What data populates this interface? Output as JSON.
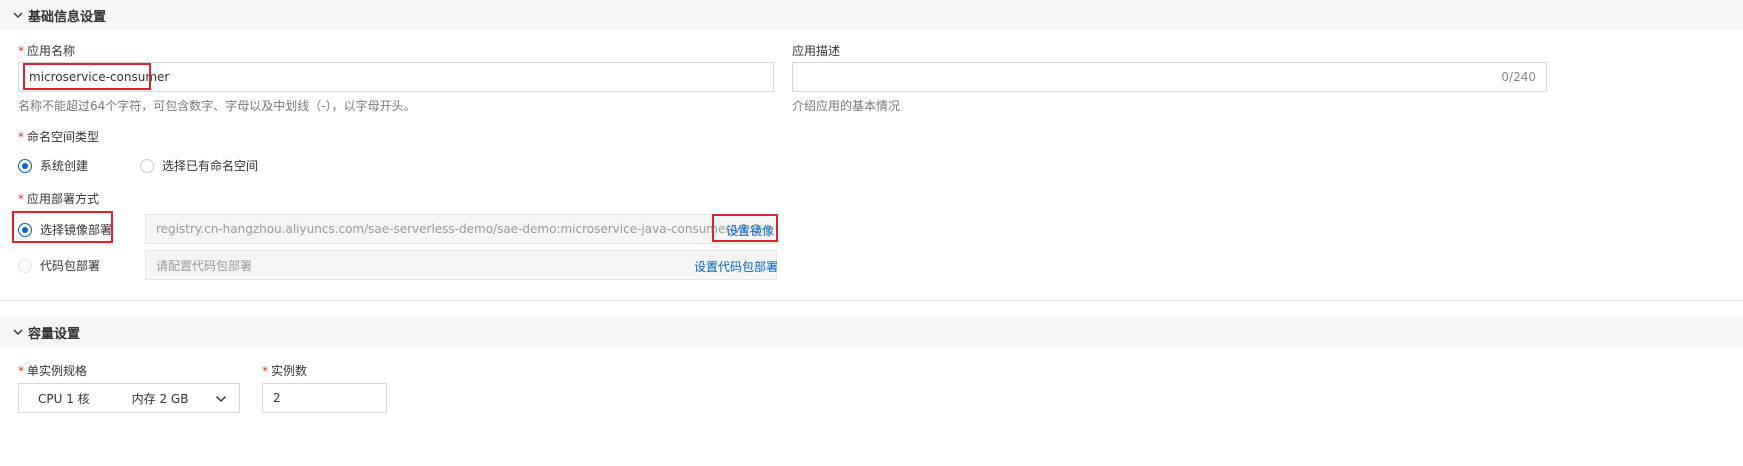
{
  "basic": {
    "section_title": "基础信息设置",
    "app_name": {
      "label": "应用名称",
      "value": "microservice-consumer",
      "hint": "名称不能超过64个字符，可包含数字、字母以及中划线（-），以字母开头。"
    },
    "app_desc": {
      "label": "应用描述",
      "counter": "0/240",
      "hint": "介绍应用的基本情况"
    },
    "namespace": {
      "label": "命名空间类型",
      "options": [
        "系统创建",
        "选择已有命名空间"
      ],
      "selected": "系统创建"
    },
    "deploy": {
      "label": "应用部署方式",
      "image_option": "选择镜像部署",
      "image_value": "registry.cn-hangzhou.aliyuncs.com/sae-serverless-demo/sae-demo:microservice-java-consumer-v1.0",
      "image_link": "设置镜像",
      "package_option": "代码包部署",
      "package_placeholder": "请配置代码包部署",
      "package_link": "设置代码包部署",
      "selected": "选择镜像部署"
    }
  },
  "capacity": {
    "section_title": "容量设置",
    "spec": {
      "label": "单实例规格",
      "cpu": "CPU 1 核",
      "memory": "内存 2 GB"
    },
    "instances": {
      "label": "实例数",
      "value": "2"
    }
  },
  "colors": {
    "accent": "#0064c8",
    "required": "#d93026",
    "highlight_box": "#d9232d"
  }
}
